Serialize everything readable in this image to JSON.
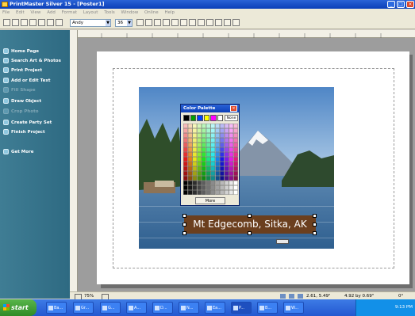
{
  "window": {
    "title": "PrintMaster Silver 15 - [Poster1]"
  },
  "menu": [
    "File",
    "Edit",
    "View",
    "Add",
    "Format",
    "Layout",
    "Tools",
    "Window",
    "Online",
    "Help"
  ],
  "toolbar": {
    "font": "Andy",
    "size": "36"
  },
  "nav": [
    {
      "label": "Home Page",
      "enabled": true
    },
    {
      "label": "Search Art & Photos",
      "enabled": true
    },
    {
      "label": "Print Project",
      "enabled": true
    },
    {
      "label": "Add or Edit Text",
      "enabled": true
    },
    {
      "label": "Fill Shape",
      "enabled": false
    },
    {
      "label": "Draw Object",
      "enabled": true
    },
    {
      "label": "Crop Photo",
      "enabled": false
    },
    {
      "label": "Create Party Set",
      "enabled": true
    },
    {
      "label": "Finish Project",
      "enabled": true
    },
    {
      "label": "Get More",
      "enabled": true
    }
  ],
  "palette": {
    "title": "Color Palette",
    "none_label": "None",
    "more_label": "More",
    "swatches": [
      "#000000",
      "#00a000",
      "#0040ff",
      "#ffff00",
      "#ff00ff",
      "#ffffff"
    ]
  },
  "caption": {
    "text": "Mt Edgecomb, Sitka, AK",
    "background": "#6b3f1e"
  },
  "status": {
    "zoom": "75%",
    "position": "2.61, 5.49\"",
    "size": "4.92 by 0.69\"",
    "angle": "0°"
  },
  "taskbar": {
    "start": "start",
    "tasks": [
      "Ba...",
      "Gr...",
      "G...",
      "A...",
      "D...",
      "N...",
      "Ea...",
      "P...",
      "B...",
      "W..."
    ],
    "clock": "9:13 PM"
  }
}
